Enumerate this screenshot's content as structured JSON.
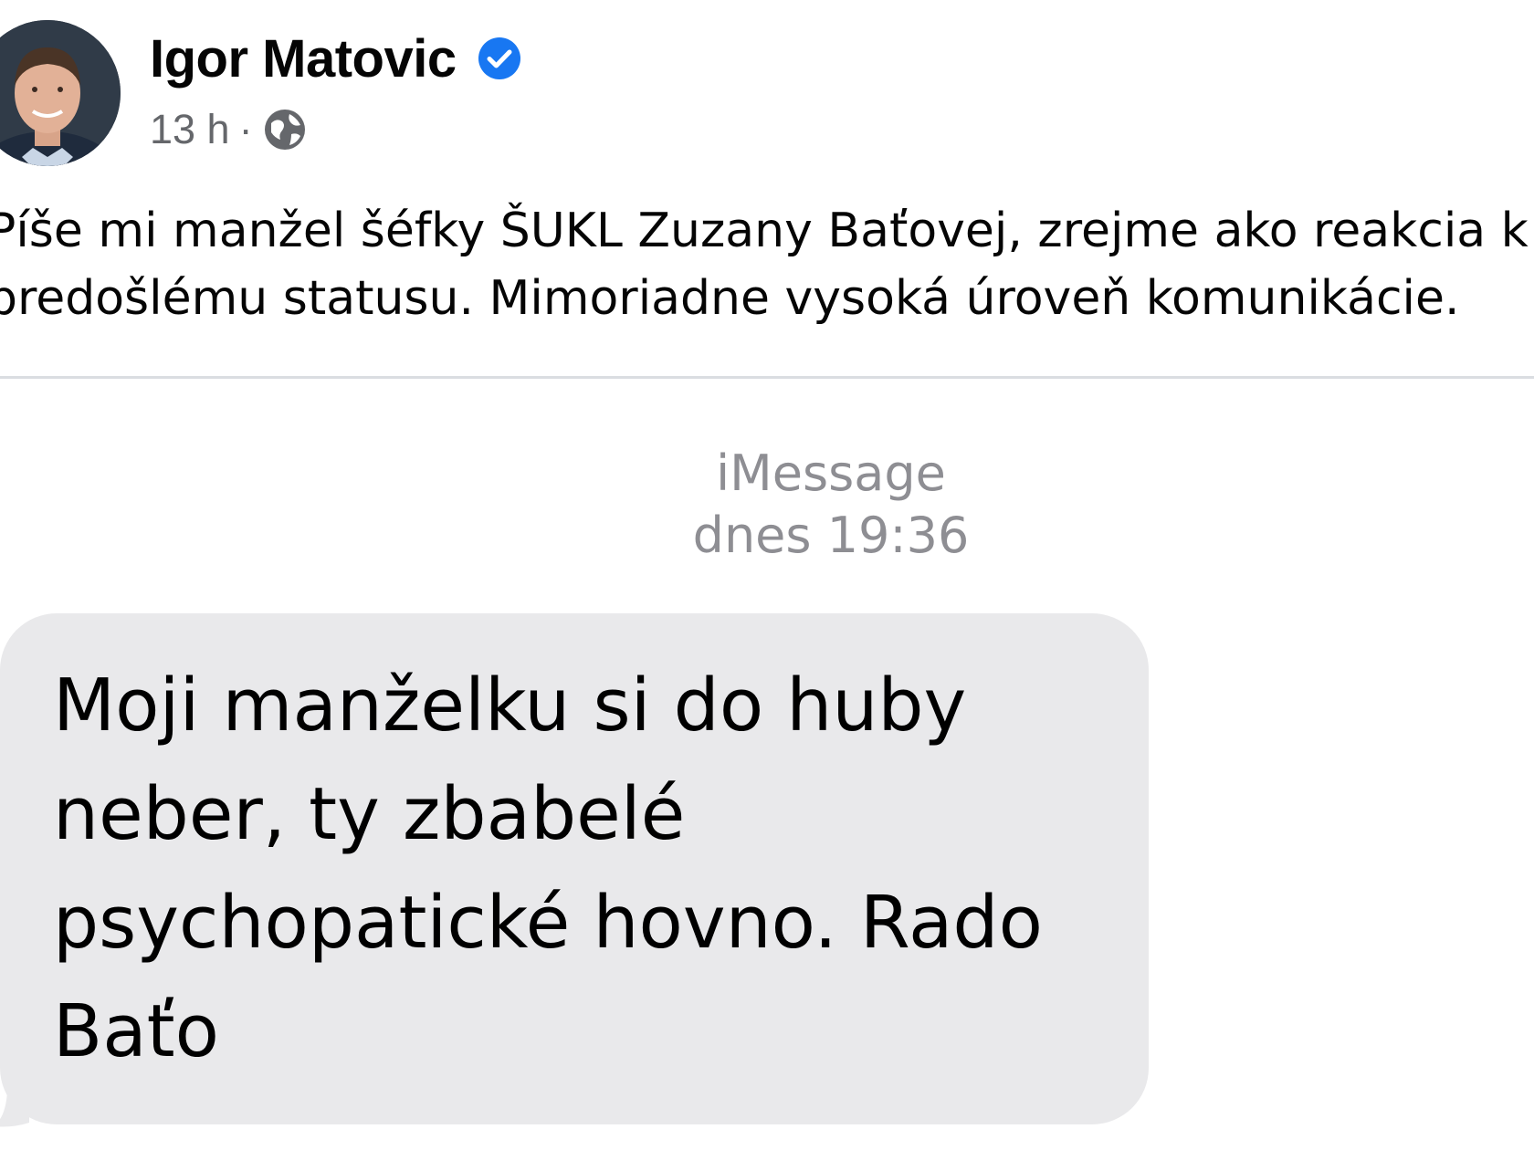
{
  "post": {
    "author": "Igor Matovic",
    "time": "13 h",
    "separator": "·",
    "text_lines": [
      "Píše mi manžel šéfky ŠUKL Zuzany Baťovej, zrejme ako reakcia k",
      "predošlému statusu. Mimoriadne vysoká úroveň komunikácie."
    ],
    "icons": {
      "verified": "verified-badge-icon",
      "audience": "globe-icon"
    },
    "colors": {
      "verified": "#1877f2",
      "meta": "#65676b",
      "text": "#050505"
    }
  },
  "imessage": {
    "service": "iMessage",
    "timestamp": "dnes 19:36",
    "message_lines": [
      "Moji manželku si do huby",
      "neber, ty zbabelé",
      "psychopatické hovno. Rado",
      "Baťo"
    ],
    "colors": {
      "bubble": "#e9e9eb",
      "header": "#8e8e93"
    }
  }
}
